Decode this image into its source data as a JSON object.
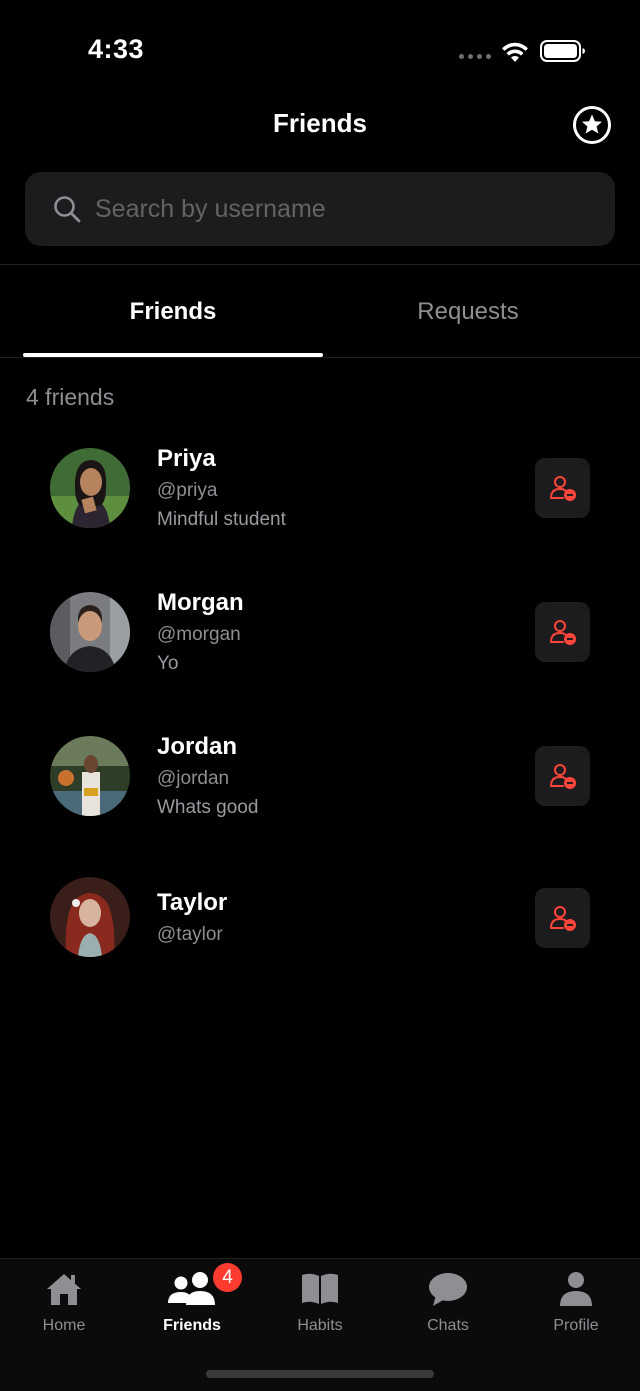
{
  "status_bar": {
    "time": "4:33"
  },
  "header": {
    "title": "Friends",
    "star_icon": "star-circle-icon"
  },
  "search": {
    "placeholder": "Search by username",
    "value": ""
  },
  "tabs": [
    {
      "label": "Friends",
      "active": true
    },
    {
      "label": "Requests",
      "active": false
    }
  ],
  "friend_count": "4 friends",
  "friends": [
    {
      "name": "Priya",
      "handle": "@priya",
      "bio": "Mindful student"
    },
    {
      "name": "Morgan",
      "handle": "@morgan",
      "bio": "Yo"
    },
    {
      "name": "Jordan",
      "handle": "@jordan",
      "bio": "Whats good"
    },
    {
      "name": "Taylor",
      "handle": "@taylor",
      "bio": ""
    }
  ],
  "tab_bar": {
    "items": [
      {
        "label": "Home",
        "icon": "house-icon"
      },
      {
        "label": "Friends",
        "icon": "people-icon",
        "active": true
      },
      {
        "label": "Habits",
        "icon": "book-icon"
      },
      {
        "label": "Chats",
        "icon": "chat-bubble-icon"
      },
      {
        "label": "Profile",
        "icon": "person-icon"
      }
    ],
    "friends_badge": "4"
  },
  "colors": {
    "accent_red": "#ff3b30",
    "background": "#000000",
    "card": "#1c1c1e",
    "secondary_text": "#8e8e93"
  }
}
